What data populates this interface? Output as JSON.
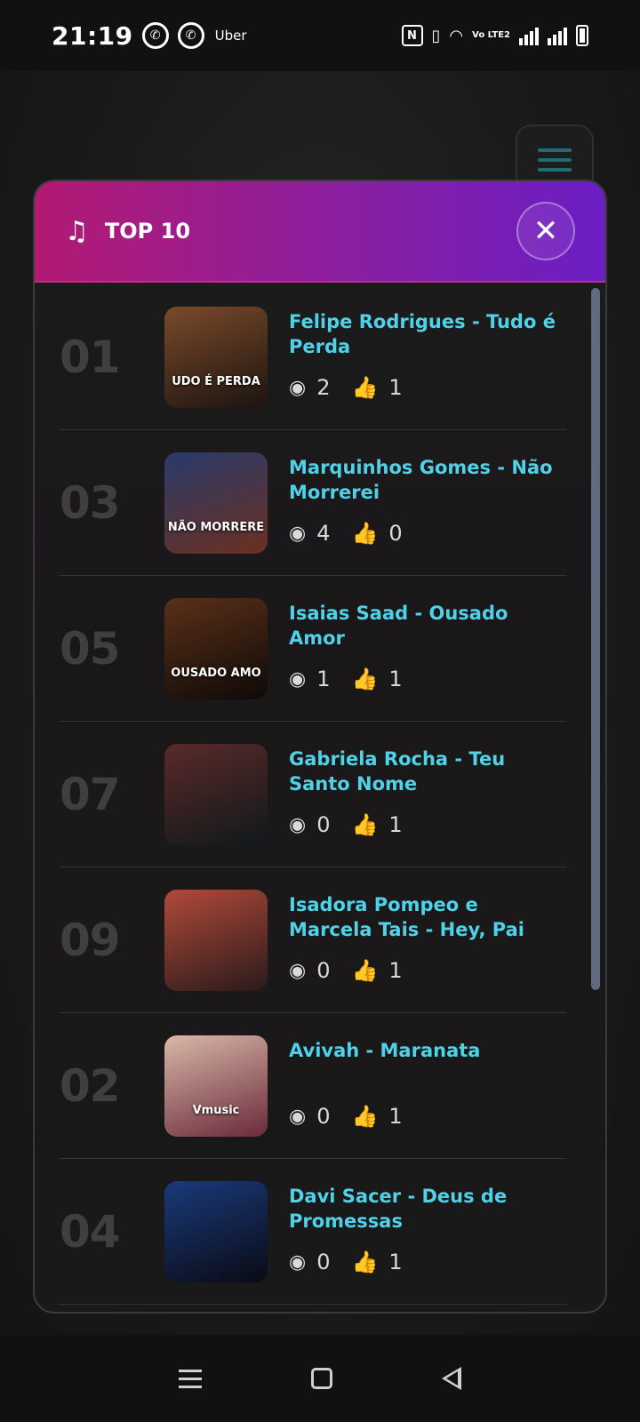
{
  "status_bar": {
    "time": "21:19",
    "uber_label": "Uber",
    "volte_label": "Vo LTE2"
  },
  "modal": {
    "title": "TOP 10",
    "close_glyph": "✕",
    "header_gradient": [
      "#b21a73",
      "#6a1ec4"
    ]
  },
  "accent_color": "#4fd1e8",
  "songs": [
    {
      "rank": "01",
      "title": "Felipe Rodrigues - Tudo é Perda",
      "views": "2",
      "likes": "1",
      "thumb_text": "UDO É PERDA",
      "thumb_colors": [
        "#7a4a2a",
        "#1c1410"
      ]
    },
    {
      "rank": "03",
      "title": "Marquinhos Gomes - Não Morrerei",
      "views": "4",
      "likes": "0",
      "thumb_text": "NÃO MORRERE",
      "thumb_colors": [
        "#2a3a6a",
        "#6a3020"
      ]
    },
    {
      "rank": "05",
      "title": "Isaias Saad - Ousado Amor",
      "views": "1",
      "likes": "1",
      "thumb_text": "OUSADO AMO",
      "thumb_colors": [
        "#5a3018",
        "#0e0a08"
      ]
    },
    {
      "rank": "07",
      "title": "Gabriela Rocha - Teu Santo Nome",
      "views": "0",
      "likes": "1",
      "thumb_text": "",
      "thumb_colors": [
        "#5a2a2a",
        "#10181a"
      ]
    },
    {
      "rank": "09",
      "title": "Isadora Pompeo e Marcela Tais - Hey, Pai",
      "views": "0",
      "likes": "1",
      "thumb_text": "",
      "thumb_colors": [
        "#b04a3a",
        "#2a1a1a"
      ]
    },
    {
      "rank": "02",
      "title": "Avivah - Maranata",
      "views": "0",
      "likes": "1",
      "thumb_text": "Vmusic",
      "thumb_colors": [
        "#d8b8a8",
        "#6a2a3a"
      ]
    },
    {
      "rank": "04",
      "title": "Davi Sacer - Deus de Promessas",
      "views": "0",
      "likes": "1",
      "thumb_text": "",
      "thumb_colors": [
        "#1a3a7a",
        "#0a0a14"
      ]
    }
  ]
}
